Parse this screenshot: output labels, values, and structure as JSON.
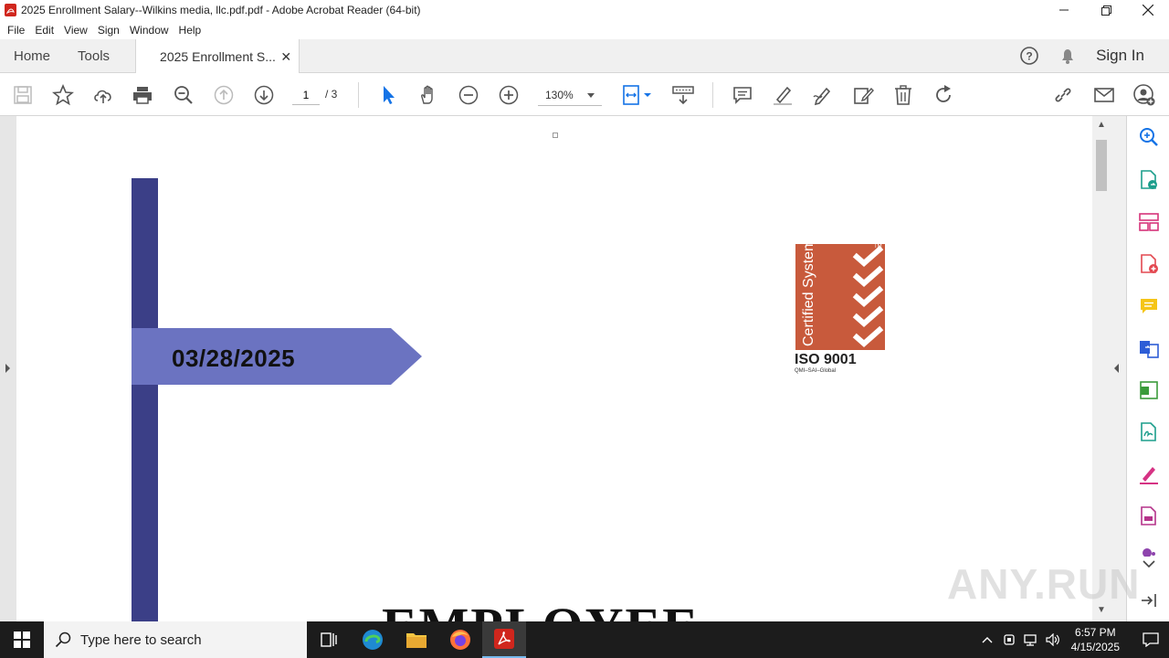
{
  "window": {
    "title": "2025 Enrollment  Salary--Wilkins media, llc.pdf.pdf - Adobe Acrobat Reader (64-bit)"
  },
  "menu": [
    "File",
    "Edit",
    "View",
    "Sign",
    "Window",
    "Help"
  ],
  "tabs": {
    "home": "Home",
    "tools": "Tools",
    "document": "2025 Enrollment  S...",
    "sign_in": "Sign In"
  },
  "toolbar": {
    "page_current": "1",
    "page_total": "/  3",
    "zoom": "130%"
  },
  "document": {
    "date": "03/28/2025",
    "iso_logo_text": "Certified System",
    "iso_label": "ISO 9001",
    "iso_sub": "QMI–SAI–Global",
    "heading": "EMPLOYEE"
  },
  "watermark": "ANY.RUN",
  "taskbar": {
    "search_placeholder": "Type here to search",
    "time": "6:57 PM",
    "date": "4/15/2025"
  },
  "colors": {
    "acrobat_red": "#d0261d",
    "banner_blue": "#6b73c1",
    "bar_navy": "#3b3f87",
    "iso_orange": "#c85a3c",
    "accent_blue": "#1473e6"
  }
}
